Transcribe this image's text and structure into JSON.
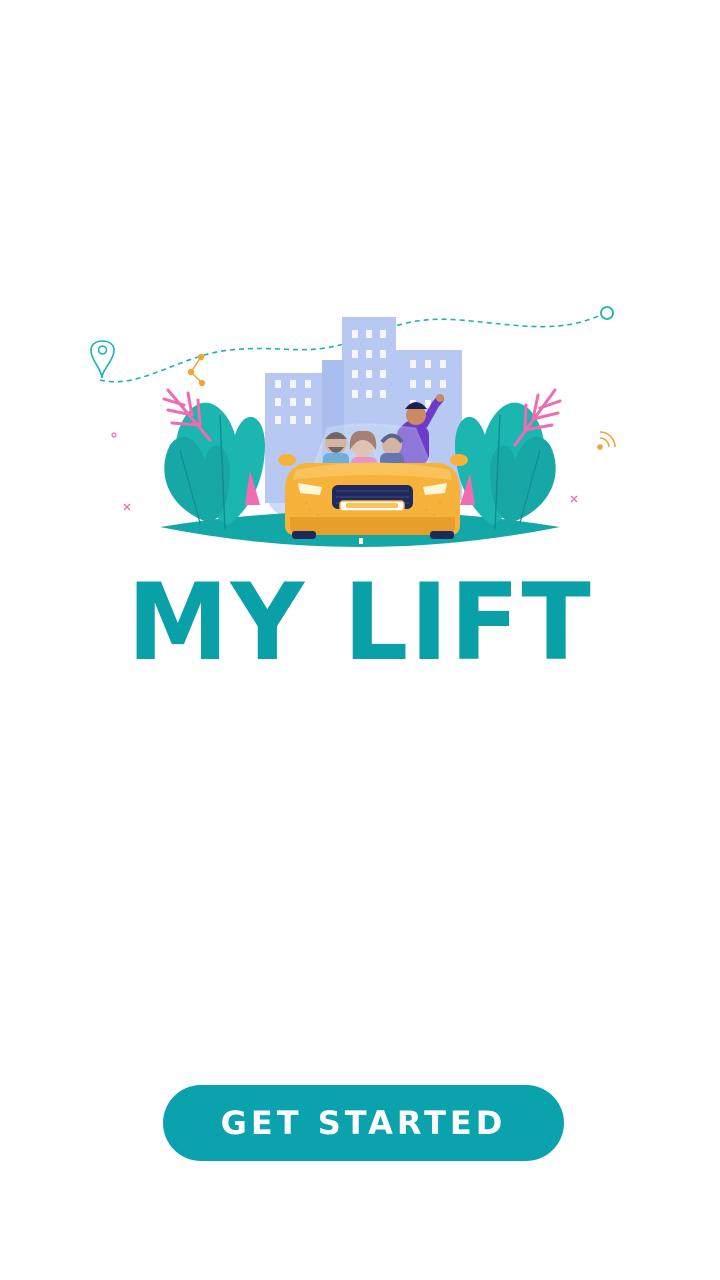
{
  "app": {
    "title": "MY LIFT"
  },
  "hero": {
    "illustration": "friends-in-yellow-car-city-illustration",
    "icons": [
      "location-pin-icon",
      "route-nodes-icon",
      "signal-waves-icon",
      "target-circle-icon"
    ]
  },
  "actions": {
    "get_started_label": "GET STARTED"
  },
  "colors": {
    "brand_teal": "#0aa0a8",
    "button_teal": "#0aa3ad",
    "car_yellow": "#f7b23b",
    "leaf_teal": "#1bb6b0",
    "leaf_pink": "#f06bb0",
    "building_blue": "#b9cbf2"
  }
}
